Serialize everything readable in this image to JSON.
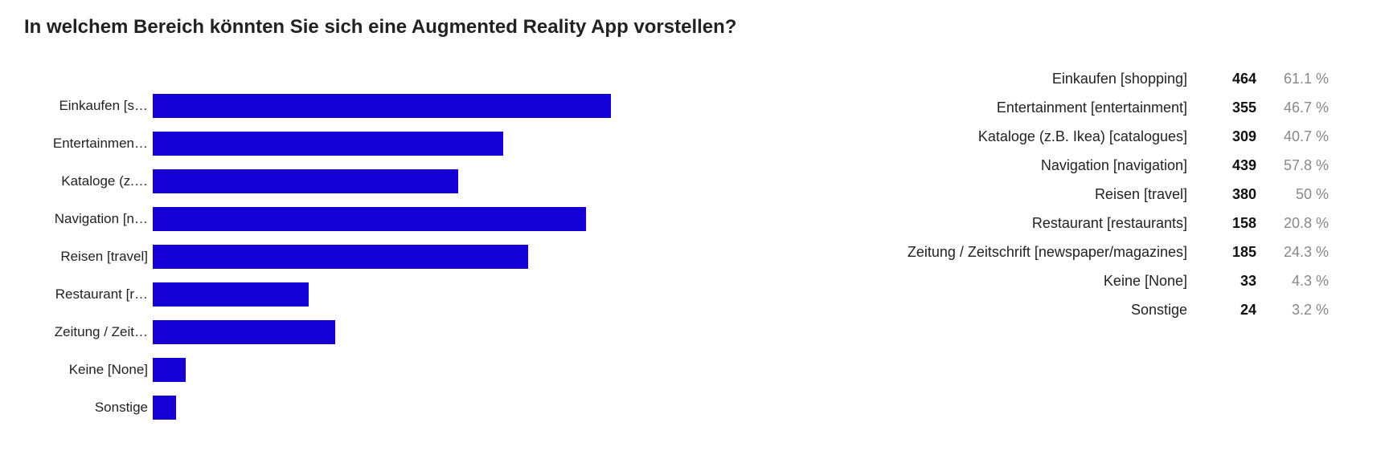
{
  "title": "In welchem Bereich könnten Sie sich eine Augmented Reality App vorstellen?",
  "chart_data": {
    "type": "bar",
    "orientation": "horizontal",
    "title": "In welchem Bereich könnten Sie sich eine Augmented Reality App vorstellen?",
    "categories": [
      "Einkaufen [shopping]",
      "Entertainment [entertainment]",
      "Kataloge (z.B. Ikea) [catalogues]",
      "Navigation [navigation]",
      "Reisen [travel]",
      "Restaurant [restaurants]",
      "Zeitung / Zeitschrift [newspaper/magazines]",
      "Keine [None]",
      "Sonstige"
    ],
    "values": [
      464,
      355,
      309,
      439,
      380,
      158,
      185,
      33,
      24
    ],
    "percent": [
      61.1,
      46.7,
      40.7,
      57.8,
      50,
      20.8,
      24.3,
      4.3,
      3.2
    ],
    "bar_labels_truncated": [
      "Einkaufen [s…",
      "Entertainmen…",
      "Kataloge (z.…",
      "Navigation [n…",
      "Reisen [travel]",
      "Restaurant [r…",
      "Zeitung / Zeit…",
      "Keine [None]",
      "Sonstige"
    ],
    "percent_display": [
      "61.1 %",
      "46.7 %",
      "40.7 %",
      "57.8 %",
      "50 %",
      "20.8 %",
      "24.3 %",
      "4.3 %",
      "3.2 %"
    ],
    "bar_color": "#1400d4",
    "xlim": [
      0,
      500
    ]
  }
}
